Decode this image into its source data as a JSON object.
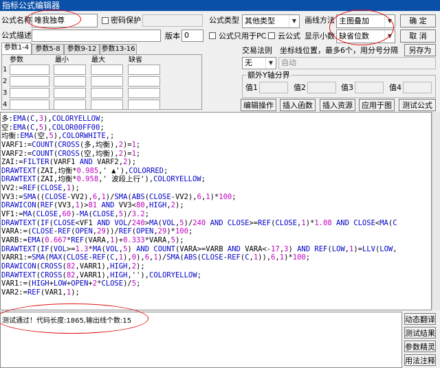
{
  "window": {
    "title": "指标公式编辑器"
  },
  "form": {
    "name_label": "公式名称",
    "name_value": "唯我独尊",
    "password_label": "密码保护",
    "type_label": "公式类型",
    "type_value": "其他类型",
    "draw_label": "画线方法",
    "draw_value": "主图叠加",
    "confirm_button": "确 定",
    "desc_label": "公式描述",
    "version_label": "版本",
    "version_value": "0",
    "pc_only_label": "公式只用于PC",
    "cloud_label": "云公式",
    "show_decimal_label": "显示小数",
    "decimal_value": "缺省位数",
    "cancel_button": "取 消",
    "saveas_button": "另存为"
  },
  "param_tabs": [
    "参数1-4",
    "参数5-8",
    "参数9-12",
    "参数13-16"
  ],
  "param_table": {
    "headers": [
      "参数",
      "最小",
      "最大",
      "缺省"
    ],
    "rows": [
      "1",
      "2",
      "3",
      "4"
    ]
  },
  "trade_rule": {
    "label": "交易法则",
    "hint": "坐标线位置，最多6个，用分号分隔",
    "value": "无",
    "auto_placeholder": "自动"
  },
  "extra_y": {
    "label": "额外Y轴分界",
    "values": [
      "值1",
      "值2",
      "值3",
      "值4"
    ]
  },
  "buttons": {
    "edit_ops": "编辑操作",
    "insert_func": "插入函数",
    "insert_resource": "插入资源",
    "apply_chart": "应用于图",
    "test_formula": "测试公式"
  },
  "code_lines": [
    "多:EMA(C,3),COLORYELLOW;",
    "空:EMA(C,5),COLOR00FF00;",
    "均衡:EMA(空,5),COLORWHITE,;",
    "VARF1:=COUNT(CROSS(多,均衡),2)=1;",
    "VARF2:=COUNT(CROSS(空,均衡),2)=1;",
    "ZAI:=FILTER(VARF1 AND VARF2,2);",
    "DRAWTEXT(ZAI,均衡*0.985,' ▲'),COLORRED;",
    "DRAWTEXT(ZAI,均衡*0.958,' 波段上行'),COLORYELLOW;",
    "VV2:=REF(CLOSE,1);",
    "VV3:=SMA((CLOSE-VV2),6,1)/SMA(ABS(CLOSE-VV2),6,1)*100;",
    "DRAWICON(REF(VV3,1)>81 AND VV3<80,HIGH,2);",
    "VF1:=MA(CLOSE,60)-MA(CLOSE,5)/3.2;",
    "DRAWTEXT(IF(CLOSE<VF1 AND VOL/240>MA(VOL,5)/240 AND CLOSE>=REF(CLOSE,1)*1.08 AND CLOSE<MA(C",
    "VARA:=(CLOSE-REF(OPEN,29))/REF(OPEN,29)*100;",
    "VARB:=EMA(0.667*REF(VARA,1)+0.333*VARA,5);",
    "DRAWTEXT(IF(VOL>=1.3*MA(VOL,5) AND COUNT(VARA>=VARB AND VARA<-17,3) AND REF(LOW,1)=LLV(LOW,",
    "VARR1:=SMA(MAX(CLOSE-REF(C,1),0),6,1)/SMA(ABS(CLOSE-REF(C,1)),6,1)*100;",
    "DRAWICON(CROSS(82,VARR1),HIGH,2);",
    "DRAWTEXT(CROSS(82,VARR1),HIGH,''),COLORYELLOW;",
    "VAR1:=(HIGH+LOW+OPEN+2*CLOSE)/5;",
    "VAR2:=REF(VAR1,1);"
  ],
  "output": {
    "message": "测试通过！代码长度:1865,输出线个数:15"
  },
  "side_buttons": [
    "动态翻译",
    "测试结果",
    "参数精灵",
    "用法注释"
  ]
}
